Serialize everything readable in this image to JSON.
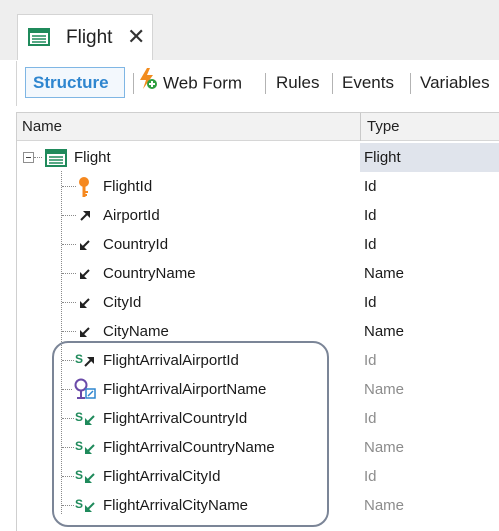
{
  "tab": {
    "title": "Flight",
    "close_glyph": "✕",
    "icon": "table-icon"
  },
  "toolbar": {
    "structure": "Structure",
    "web_form": "Web Form",
    "rules": "Rules",
    "events": "Events",
    "variables": "Variables",
    "web_form_icon": "lightning-add-icon"
  },
  "grid": {
    "columns": {
      "name": "Name",
      "type": "Type"
    },
    "root": {
      "name": "Flight",
      "type": "Flight",
      "icon": "table-icon"
    },
    "rows": [
      {
        "name": "FlightId",
        "type": "Id",
        "icon": "key-icon"
      },
      {
        "name": "AirportId",
        "type": "Id",
        "icon": "foreign-key-arrow-icon"
      },
      {
        "name": "CountryId",
        "type": "Id",
        "icon": "inferred-arrow-icon"
      },
      {
        "name": "CountryName",
        "type": "Name",
        "icon": "inferred-arrow-icon"
      },
      {
        "name": "CityId",
        "type": "Id",
        "icon": "inferred-arrow-icon"
      },
      {
        "name": "CityName",
        "type": "Name",
        "icon": "inferred-arrow-icon"
      },
      {
        "name": "FlightArrivalAirportId",
        "type": "Id",
        "icon": "subtype-fk-icon"
      },
      {
        "name": "FlightArrivalAirportName",
        "type": "Name",
        "icon": "subtype-lookup-icon"
      },
      {
        "name": "FlightArrivalCountryId",
        "type": "Id",
        "icon": "subtype-inferred-icon"
      },
      {
        "name": "FlightArrivalCountryName",
        "type": "Name",
        "icon": "subtype-inferred-icon"
      },
      {
        "name": "FlightArrivalCityId",
        "type": "Id",
        "icon": "subtype-inferred-icon"
      },
      {
        "name": "FlightArrivalCityName",
        "type": "Name",
        "icon": "subtype-inferred-icon"
      }
    ]
  },
  "colors": {
    "accent": "#2f86cf",
    "selected_cell": "#e0e4ec",
    "icon_green": "#1f8a5b",
    "dim_text": "#8c8c8c"
  }
}
